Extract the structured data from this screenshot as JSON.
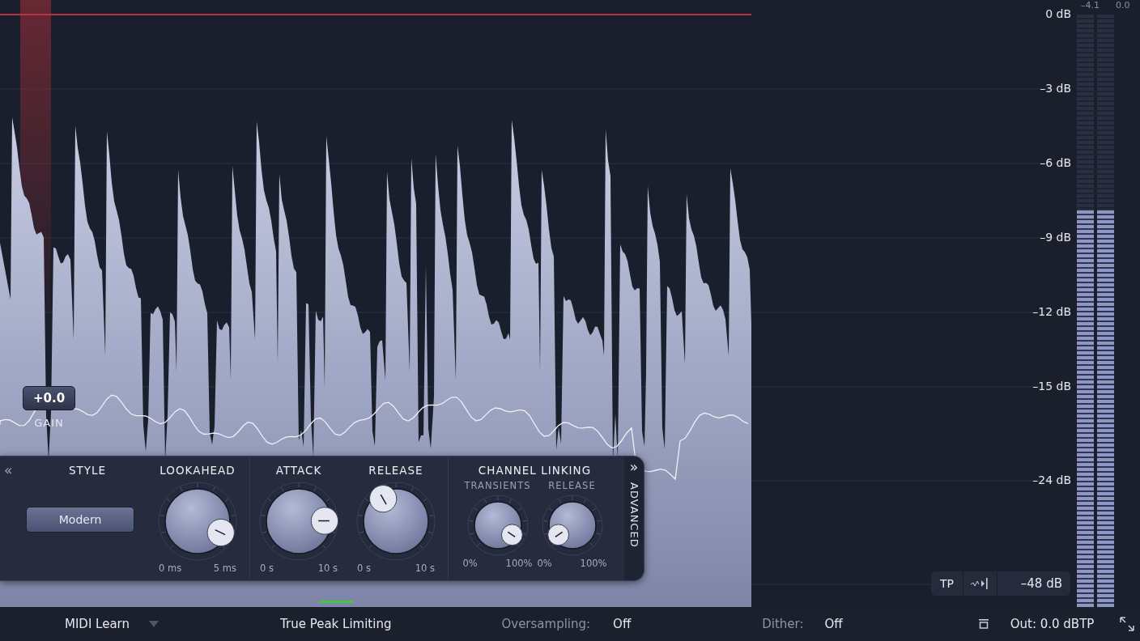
{
  "scale_labels": [
    "0 dB",
    "–3 dB",
    "–6 dB",
    "–9 dB",
    "–12 dB",
    "–15 dB",
    "–24 dB"
  ],
  "meter": {
    "readings": [
      "–4.1",
      "0.0"
    ],
    "channels": [
      {
        "level": 0.67
      },
      {
        "level": 0.67
      }
    ]
  },
  "gain": {
    "value": "+0.0",
    "label": "GAIN"
  },
  "panel": {
    "collapse": "«",
    "style": {
      "title": "STYLE",
      "button": "Modern"
    },
    "knobs": [
      {
        "title": "LOOKAHEAD",
        "min": "0 ms",
        "max": "5 ms"
      },
      {
        "title": "ATTACK",
        "min": "0 s",
        "max": "10 s"
      },
      {
        "title": "RELEASE",
        "min": "0 s",
        "max": "10 s"
      }
    ],
    "channel_linking": {
      "title": "CHANNEL LINKING",
      "knobs": [
        {
          "title": "TRANSIENTS",
          "min": "0%",
          "max": "100%"
        },
        {
          "title": "RELEASE",
          "min": "0%",
          "max": "100%"
        }
      ]
    },
    "advanced": {
      "icon": "»",
      "label": "ADVANCED"
    }
  },
  "meter_controls": {
    "tp": "TP",
    "readout": "–48 dB"
  },
  "status_bar": {
    "midi_learn": "MIDI Learn",
    "true_peak": {
      "label": "True Peak Limiting",
      "on": true
    },
    "oversampling": {
      "label": "Oversampling:",
      "value": "Off"
    },
    "dither": {
      "label": "Dither:",
      "value": "Off"
    },
    "output": "Out: 0.0 dBTP"
  }
}
